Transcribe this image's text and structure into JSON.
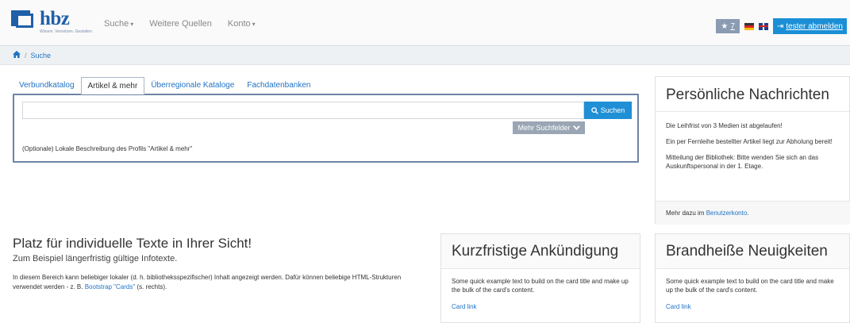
{
  "brand": {
    "name": "hbz",
    "tagline": "Wissen. Vernetzen. Gestalten."
  },
  "nav": {
    "items": [
      {
        "label": "Suche",
        "caret": "▾"
      },
      {
        "label": "Weitere Quellen",
        "caret": ""
      },
      {
        "label": "Konto",
        "caret": "▾"
      }
    ],
    "watchlist_count": "7",
    "logout_label": "tester abmelden"
  },
  "breadcrumb": {
    "home_icon": "home-icon",
    "current": "Suche"
  },
  "search": {
    "tabs": [
      "Verbundkatalog",
      "Artikel & mehr",
      "Überregionale Kataloge",
      "Fachdatenbanken"
    ],
    "active_tab": 1,
    "query": "",
    "button_label": "Suchen",
    "more_fields_label": "Mehr Suchfelder",
    "profile_description": "(Optionale) Lokale Beschreibung des Profils \"Artikel & mehr\""
  },
  "messages": {
    "title": "Persönliche Nachrichten",
    "items": [
      "Die Leihfrist von 3 Medien ist abgelaufen!",
      "Ein per Fernleihe bestellter Artikel liegt zur Abholung bereit!",
      "Mitteilung der Bibliothek: Bitte wenden Sie sich an das Auskunftspersonal in der 1. Etage."
    ],
    "footer_prefix": "Mehr dazu im ",
    "footer_link": "Benutzerkonto",
    "footer_suffix": "."
  },
  "info": {
    "title": "Platz für individuelle Texte in Ihrer Sicht!",
    "subtitle": "Zum Beispiel längerfristig gültige Infotexte.",
    "body_prefix": "In diesem Bereich kann beliebiger lokaler (d. h. bibliotheksspezifischer) Inhalt angezeigt werden. Dafür können beliebige HTML-Strukturen verwendet werden - z. B. ",
    "body_link": "Bootstrap \"Cards\"",
    "body_suffix": " (s. rechts)."
  },
  "cards": [
    {
      "title": "Kurzfristige Ankündigung",
      "text": "Some quick example text to build on the card title and make up the bulk of the card's content.",
      "link": "Card link"
    },
    {
      "title": "Brandheiße Neuigkeiten",
      "text": "Some quick example text to build on the card title and make up the bulk of the card's content.",
      "link": "Card link"
    }
  ],
  "colors": {
    "primary": "#1f8fd6",
    "brand": "#1f5fa8",
    "panel_border": "#6f84a6",
    "link": "#1f73c4"
  }
}
